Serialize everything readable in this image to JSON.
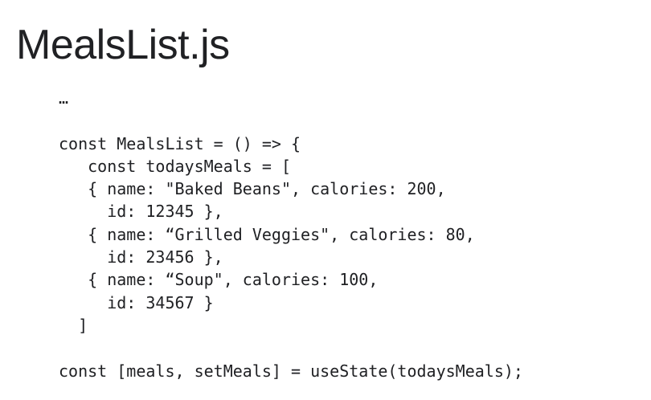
{
  "slide": {
    "title": "MealsList.js"
  },
  "code": {
    "lines": [
      "…",
      "",
      "const MealsList = () => {",
      "   const todaysMeals = [",
      "   { name: \"Baked Beans\", calories: 200,",
      "     id: 12345 },",
      "   { name: “Grilled Veggies\", calories: 80,",
      "     id: 23456 },",
      "   { name: “Soup\", calories: 100,",
      "     id: 34567 }",
      "  ]",
      "",
      "const [meals, setMeals] = useState(todaysMeals);"
    ]
  }
}
